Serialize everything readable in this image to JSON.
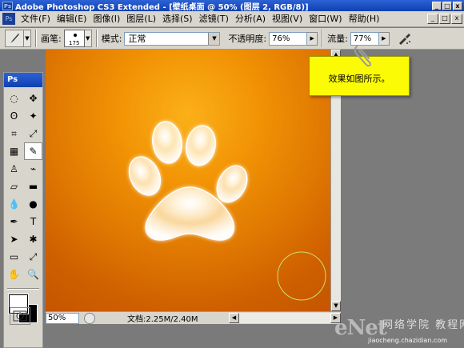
{
  "window": {
    "title": "Adobe Photoshop CS3 Extended - [壁纸桌面 @ 50% (图层 2, RGB/8)]",
    "app_icon": "Ps",
    "controls": [
      "_",
      "□",
      "x"
    ]
  },
  "menubar": {
    "ps_icon": "Ps",
    "items": [
      "文件(F)",
      "编辑(E)",
      "图像(I)",
      "图层(L)",
      "选择(S)",
      "滤镜(T)",
      "分析(A)",
      "视图(V)",
      "窗口(W)",
      "帮助(H)"
    ],
    "doc_controls": [
      "_",
      "□",
      "x"
    ]
  },
  "options": {
    "brush_label": "画笔:",
    "brush_size": "175",
    "mode_label": "模式:",
    "mode_value": "正常",
    "opacity_label": "不透明度:",
    "opacity_value": "76%",
    "flow_label": "流量:",
    "flow_value": "77%"
  },
  "toolbox": {
    "header": "Ps",
    "tools": [
      {
        "name": "marquee-icon",
        "glyph": "◌"
      },
      {
        "name": "move-icon",
        "glyph": "✥"
      },
      {
        "name": "lasso-icon",
        "glyph": "ʘ"
      },
      {
        "name": "magic-wand-icon",
        "glyph": "✦"
      },
      {
        "name": "crop-icon",
        "glyph": "⌗"
      },
      {
        "name": "eyedropper-icon",
        "glyph": "⤢"
      },
      {
        "name": "healing-brush-icon",
        "glyph": "▦"
      },
      {
        "name": "brush-icon",
        "glyph": "✎"
      },
      {
        "name": "clone-stamp-icon",
        "glyph": "♙"
      },
      {
        "name": "history-brush-icon",
        "glyph": "⌁"
      },
      {
        "name": "eraser-icon",
        "glyph": "▱"
      },
      {
        "name": "gradient-icon",
        "glyph": "▬"
      },
      {
        "name": "blur-icon",
        "glyph": "💧"
      },
      {
        "name": "dodge-icon",
        "glyph": "●"
      },
      {
        "name": "pen-icon",
        "glyph": "✒"
      },
      {
        "name": "type-icon",
        "glyph": "T"
      },
      {
        "name": "path-selection-icon",
        "glyph": "➤"
      },
      {
        "name": "custom-shape-icon",
        "glyph": "✱"
      },
      {
        "name": "notes-icon",
        "glyph": "▭"
      },
      {
        "name": "eyedropper2-icon",
        "glyph": "⤢"
      },
      {
        "name": "hand-icon",
        "glyph": "✋"
      },
      {
        "name": "zoom-icon",
        "glyph": "🔍"
      }
    ],
    "foreground_color": "#ffffff",
    "background_color": "#000000"
  },
  "note": {
    "text": "效果如图所示。"
  },
  "status": {
    "zoom": "50%",
    "doc_info": "文档:2.25M/2.40M"
  },
  "watermark": {
    "logo": "eNet",
    "cn_line": "网络学院 教程网",
    "url": "jiaocheng.chazidian.com"
  },
  "colors": {
    "canvas_center": "#fbb018",
    "canvas_edge": "#c55500",
    "note_bg": "#fbfb06",
    "title_blue": "#1040b0"
  }
}
